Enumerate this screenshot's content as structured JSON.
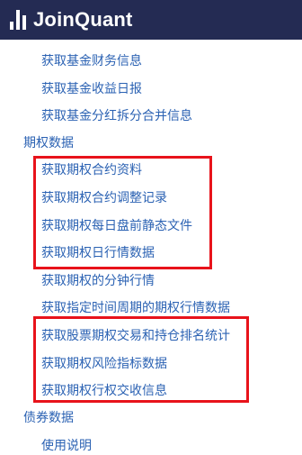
{
  "header": {
    "brand": "JoinQuant"
  },
  "nav": {
    "items": [
      {
        "label": "获取基金财务信息"
      },
      {
        "label": "获取基金收益日报"
      },
      {
        "label": "获取基金分红拆分合并信息"
      },
      {
        "label": "期权数据"
      },
      {
        "label": "获取期权合约资料"
      },
      {
        "label": "获取期权合约调整记录"
      },
      {
        "label": "获取期权每日盘前静态文件"
      },
      {
        "label": "获取期权日行情数据"
      },
      {
        "label": "获取期权的分钟行情"
      },
      {
        "label": "获取指定时间周期的期权行情数据"
      },
      {
        "label": "获取股票期权交易和持仓排名统计"
      },
      {
        "label": "获取期权风险指标数据"
      },
      {
        "label": "获取期权行权交收信息"
      },
      {
        "label": "债券数据"
      },
      {
        "label": "使用说明"
      }
    ]
  },
  "colors": {
    "header_bg": "#242b53",
    "link": "#2b62b3",
    "highlight": "#e8131b"
  }
}
